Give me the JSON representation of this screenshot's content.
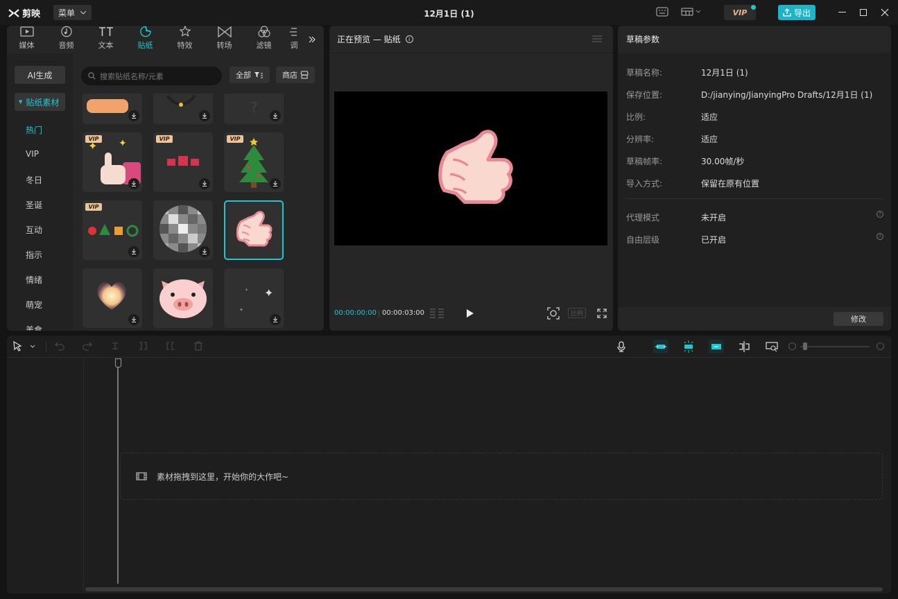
{
  "app": {
    "name": "剪映",
    "menu_label": "菜单",
    "title": "12月1日 (1)",
    "vip_label": "VIP",
    "export_label": "导出"
  },
  "tabs": [
    {
      "label": "媒体",
      "icon": "media-icon"
    },
    {
      "label": "音频",
      "icon": "audio-icon"
    },
    {
      "label": "文本",
      "icon": "text-icon"
    },
    {
      "label": "贴纸",
      "icon": "sticker-icon",
      "active": true
    },
    {
      "label": "特效",
      "icon": "effects-icon"
    },
    {
      "label": "转场",
      "icon": "transition-icon"
    },
    {
      "label": "滤镜",
      "icon": "filter-icon"
    },
    {
      "label": "调",
      "icon": "adjust-icon"
    }
  ],
  "library": {
    "ai_label": "AI生成",
    "category_label": "贴纸素材",
    "items": [
      "热门",
      "VIP",
      "冬日",
      "圣诞",
      "互动",
      "指示",
      "情绪",
      "萌宠",
      "美食"
    ],
    "search_placeholder": "搜索贴纸名称/元素",
    "filter_label": "全部",
    "store_label": "商店"
  },
  "preview": {
    "title": "正在预览 — 贴纸",
    "time_current": "00:00:00:00",
    "time_total": "00:00:03:00",
    "ratio_label": "比例"
  },
  "properties": {
    "title": "草稿参数",
    "rows": [
      {
        "label": "草稿名称:",
        "value": "12月1日 (1)"
      },
      {
        "label": "保存位置:",
        "value": "D:/jianying/JianyingPro Drafts/12月1日 (1)"
      },
      {
        "label": "比例:",
        "value": "适应"
      },
      {
        "label": "分辨率:",
        "value": "适应"
      },
      {
        "label": "草稿帧率:",
        "value": "30.00帧/秒"
      },
      {
        "label": "导入方式:",
        "value": "保留在原有位置"
      }
    ],
    "extra_rows": [
      {
        "label": "代理模式",
        "value": "未开启"
      },
      {
        "label": "自由层级",
        "value": "已开启"
      }
    ],
    "modify_label": "修改"
  },
  "timeline": {
    "drop_hint": "素材拖拽到这里，开始你的大作吧~"
  },
  "colors": {
    "accent": "#1fc6d6",
    "panel": "#262626",
    "background": "#141414"
  }
}
